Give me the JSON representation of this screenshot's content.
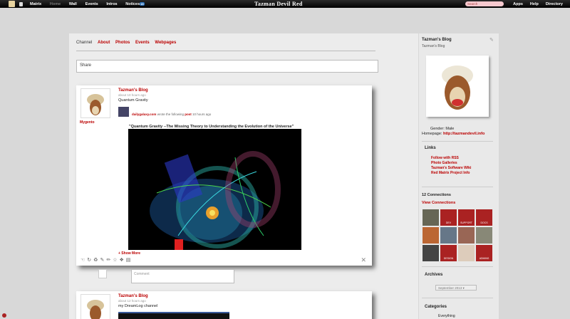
{
  "topbar": {
    "nav": [
      "Matrix",
      "Home",
      "Wall",
      "Events",
      "Intros",
      "Notices"
    ],
    "notices_count": "15",
    "site_title": "Tazman Devil Red",
    "search_placeholder": "Search",
    "right_nav": [
      "Apps",
      "Help",
      "Directory"
    ]
  },
  "tabs": [
    "Channel",
    "About",
    "Photos",
    "Events",
    "Webpages"
  ],
  "share_placeholder": "Share",
  "posts": [
    {
      "author": "Tazman's Blog",
      "ago": "about 10 hours ago",
      "title": "Quantum Gravity",
      "shared_source": "dailygalaxy.com",
      "shared_text": "wrote the following",
      "shared_kind": "post",
      "shared_ago": "10 hours ago",
      "side_link": "Mygento",
      "quote_title": "\"Quantum Gravity --The Missing Theory to Understanding the Evolution of the Universe\"",
      "show_more": "+ Show More"
    },
    {
      "author": "Tazman's Blog",
      "ago": "about 12 hours ago",
      "title": "my DreamLog channel"
    }
  ],
  "comment_placeholder": "Comment",
  "sidebar": {
    "blog_title": "Tazman's Blog",
    "blog_subtitle": "Tazman's Blog",
    "gender_label": "Gender:",
    "gender_value": "Male",
    "homepage_label": "Homepage:",
    "homepage_value": "http://tazmandevil.info",
    "links_title": "Links",
    "links": [
      "Follow with RSS",
      "Photo Galleries",
      "Tazman's Software Wiki",
      "Red Matrix Project Info"
    ],
    "connections_count": "12 Connections",
    "view_connections": "View Connections",
    "connection_labels": [
      "",
      "DEV",
      "SUPPORT",
      "DOCS",
      "",
      "",
      "",
      "",
      "",
      "DESIGN",
      "",
      "ADMINS"
    ],
    "archives_title": "Archives",
    "archive_selected": "September 2013",
    "categories_title": "Categories",
    "category_first": "Everything"
  }
}
